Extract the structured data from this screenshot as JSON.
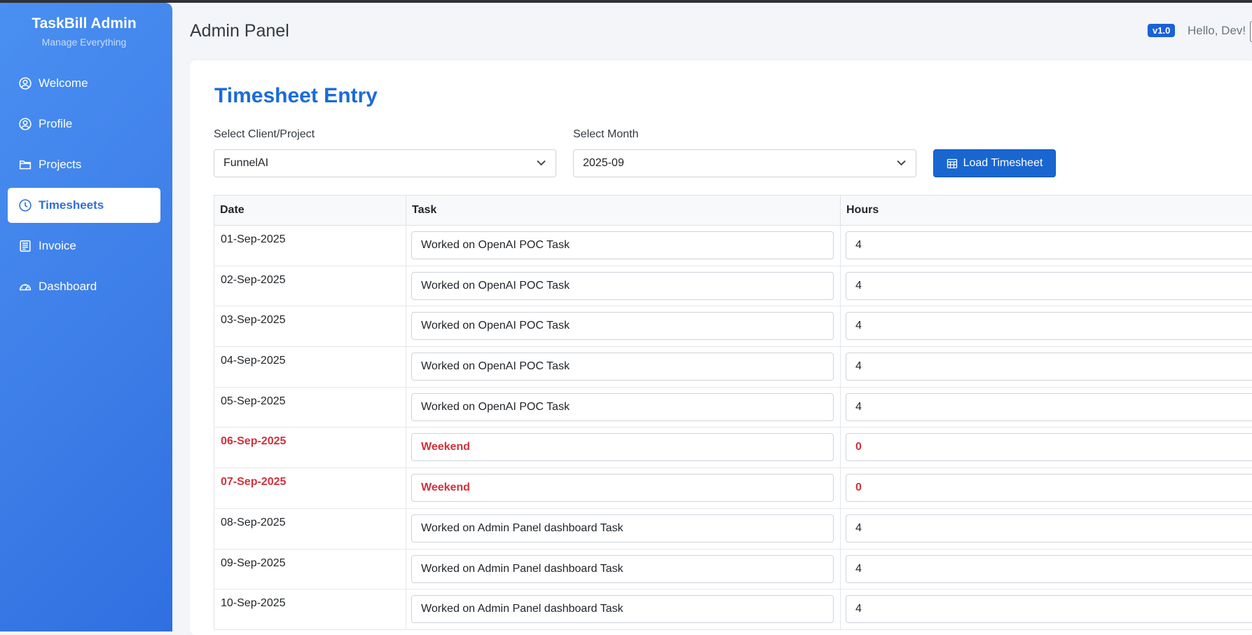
{
  "sidebar": {
    "brand_title": "TaskBill Admin",
    "brand_subtitle": "Manage Everything",
    "items": [
      {
        "label": "Welcome",
        "icon": "user-circle-icon"
      },
      {
        "label": "Profile",
        "icon": "user-circle-icon"
      },
      {
        "label": "Projects",
        "icon": "folder-icon"
      },
      {
        "label": "Timesheets",
        "icon": "clock-icon",
        "active": true
      },
      {
        "label": "Invoice",
        "icon": "receipt-icon"
      },
      {
        "label": "Dashboard",
        "icon": "speedometer-icon"
      }
    ]
  },
  "header": {
    "title": "Admin Panel",
    "version": "v1.0",
    "greeting": "Hello, Dev!"
  },
  "card": {
    "title": "Timesheet Entry",
    "client_label": "Select Client/Project",
    "client_value": "FunnelAI",
    "month_label": "Select Month",
    "month_value": "2025-09",
    "load_button": "Load Timesheet"
  },
  "table": {
    "columns": [
      "Date",
      "Task",
      "Hours"
    ],
    "rows": [
      {
        "date": "01-Sep-2025",
        "task": "Worked on OpenAI POC Task",
        "hours": "4",
        "weekend": false
      },
      {
        "date": "02-Sep-2025",
        "task": "Worked on OpenAI POC Task",
        "hours": "4",
        "weekend": false
      },
      {
        "date": "03-Sep-2025",
        "task": "Worked on OpenAI POC Task",
        "hours": "4",
        "weekend": false
      },
      {
        "date": "04-Sep-2025",
        "task": "Worked on OpenAI POC Task",
        "hours": "4",
        "weekend": false
      },
      {
        "date": "05-Sep-2025",
        "task": "Worked on OpenAI POC Task",
        "hours": "4",
        "weekend": false
      },
      {
        "date": "06-Sep-2025",
        "task": "Weekend",
        "hours": "0",
        "weekend": true
      },
      {
        "date": "07-Sep-2025",
        "task": "Weekend",
        "hours": "0",
        "weekend": true
      },
      {
        "date": "08-Sep-2025",
        "task": "Worked on Admin Panel dashboard Task",
        "hours": "4",
        "weekend": false
      },
      {
        "date": "09-Sep-2025",
        "task": "Worked on Admin Panel dashboard Task",
        "hours": "4",
        "weekend": false
      },
      {
        "date": "10-Sep-2025",
        "task": "Worked on Admin Panel dashboard Task",
        "hours": "4",
        "weekend": false
      }
    ]
  },
  "colors": {
    "accent": "#1a6bd8",
    "sidebar": "#3d7ee8",
    "weekend": "#d1313c"
  }
}
